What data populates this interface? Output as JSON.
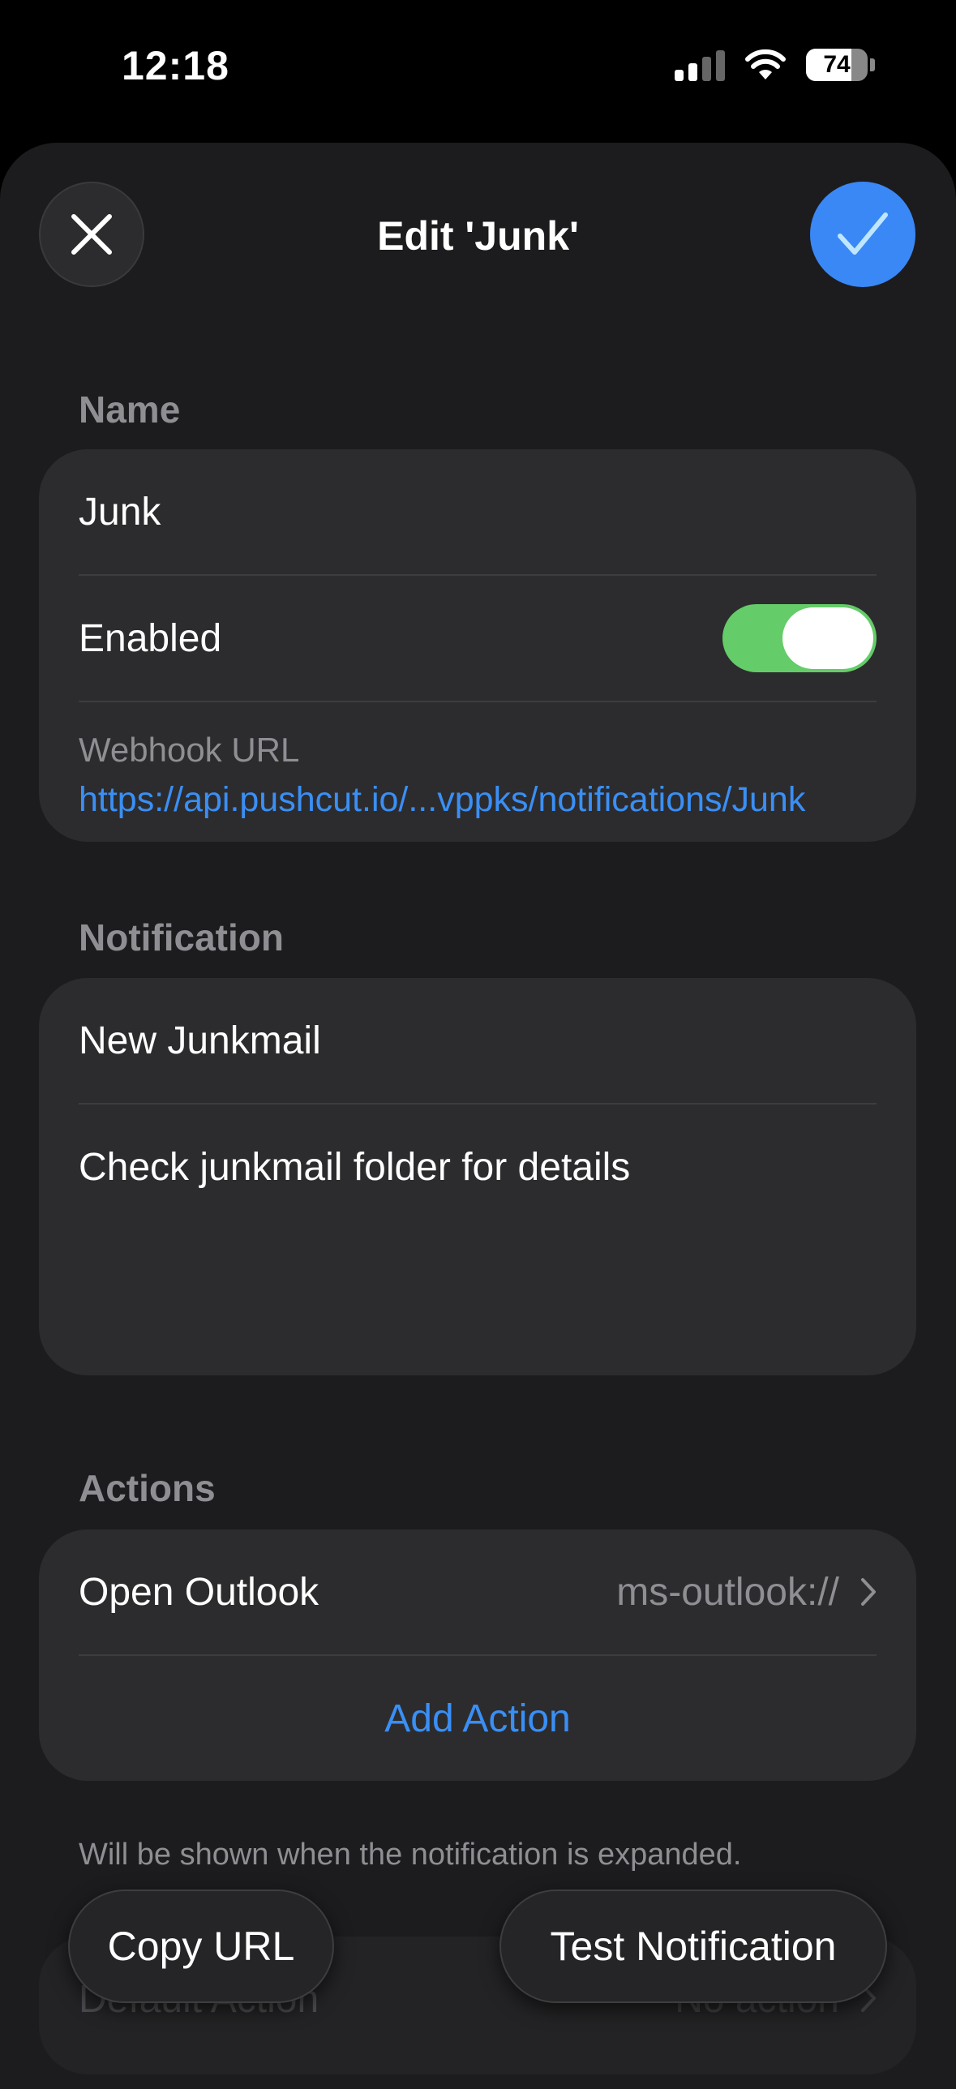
{
  "status": {
    "time": "12:18",
    "battery": "74",
    "battery_level": 0.74
  },
  "header": {
    "title": "Edit 'Junk'"
  },
  "name_section": {
    "label": "Name",
    "name_value": "Junk",
    "enabled_label": "Enabled",
    "enabled": true,
    "webhook_label": "Webhook URL",
    "webhook_url": "https://api.pushcut.io/...vppks/notifications/Junk"
  },
  "notification_section": {
    "label": "Notification",
    "title_value": "New Junkmail",
    "body_value": "Check junkmail folder for details"
  },
  "actions_section": {
    "label": "Actions",
    "action_name": "Open Outlook",
    "action_url": "ms-outlook://",
    "add_action_label": "Add Action",
    "footnote": "Will be shown when the notification is expanded."
  },
  "default_action": {
    "label": "Default Action",
    "value": "No action"
  },
  "bottom_buttons": {
    "copy_label": "Copy URL",
    "test_label": "Test Notification"
  },
  "colors": {
    "accent": "#3a88f5",
    "toggle_on": "#64cc68",
    "card": "#2c2c2e",
    "sheet": "#1c1c1e"
  }
}
